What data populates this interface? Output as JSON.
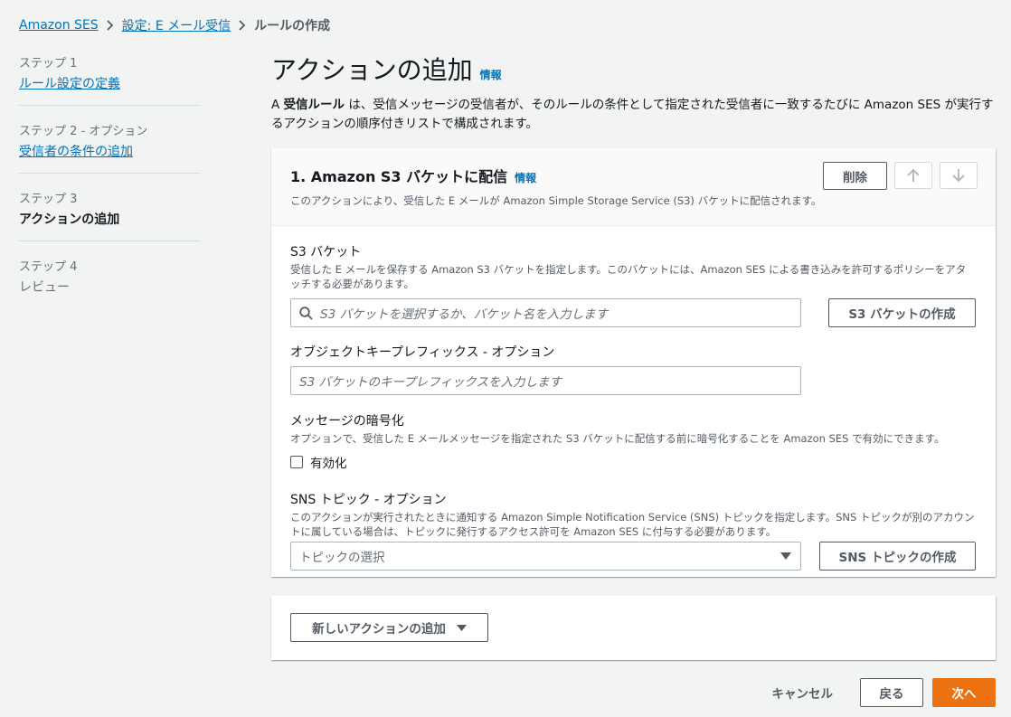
{
  "breadcrumb": {
    "items": [
      "Amazon SES",
      "設定: E メール受信"
    ],
    "current": "ルールの作成"
  },
  "steps": [
    {
      "num": "ステップ 1",
      "name": "ルール設定の定義"
    },
    {
      "num": "ステップ 2 - オプション",
      "name": "受信者の条件の追加"
    },
    {
      "num": "ステップ 3",
      "name": "アクションの追加"
    },
    {
      "num": "ステップ 4",
      "name": "レビュー"
    }
  ],
  "page": {
    "title": "アクションの追加",
    "info": "情報",
    "desc_prefix": "A ",
    "desc_bold": "受信ルール",
    "desc_rest": " は、受信メッセージの受信者が、そのルールの条件として指定された受信者に一致するたびに Amazon SES が実行するアクションの順序付きリストで構成されます。"
  },
  "action": {
    "title": "1. Amazon S3 バケットに配信",
    "info": "情報",
    "subtitle": "このアクションにより、受信した E メールが Amazon Simple Storage Service (S3) バケットに配信されます。",
    "delete_label": "削除",
    "s3": {
      "label": "S3 バケット",
      "desc": "受信した E メールを保存する Amazon S3 バケットを指定します。このバケットには、Amazon SES による書き込みを許可するポリシーをアタッチする必要があります。",
      "placeholder": "S3 バケットを選択するか、バケット名を入力します",
      "create_label": "S3 バケットの作成"
    },
    "prefix": {
      "label": "オブジェクトキープレフィックス - オプション",
      "placeholder": "S3 バケットのキープレフィックスを入力します"
    },
    "encryption": {
      "label": "メッセージの暗号化",
      "desc": "オプションで、受信した E メールメッセージを指定された S3 バケットに配信する前に暗号化することを Amazon SES で有効にできます。",
      "checkbox_label": "有効化"
    },
    "sns": {
      "label": "SNS トピック - オプション",
      "desc": "このアクションが実行されたときに通知する Amazon Simple Notification Service (SNS) トピックを指定します。SNS トピックが別のアカウントに属している場合は、トピックに発行するアクセス許可を Amazon SES に付与する必要があります。",
      "placeholder": "トピックの選択",
      "create_label": "SNS トピックの作成"
    }
  },
  "add_action_label": "新しいアクションの追加",
  "footer": {
    "cancel": "キャンセル",
    "back": "戻る",
    "next": "次へ"
  },
  "colors": {
    "link": "#0073bb",
    "primary": "#ec7211",
    "background": "#f2f3f3"
  }
}
